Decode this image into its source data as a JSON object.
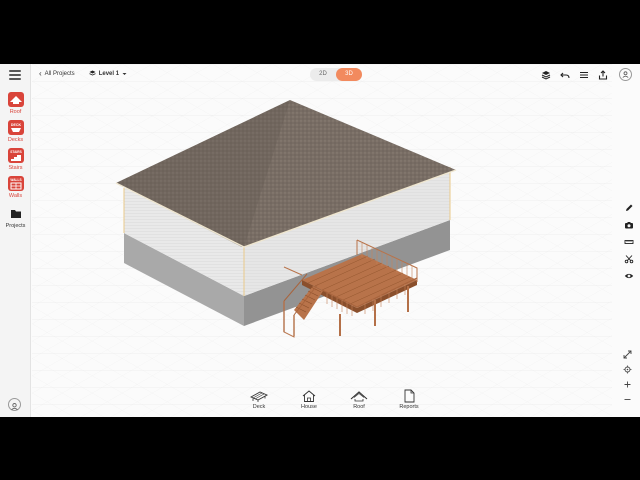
{
  "topbar": {
    "back_label": "All Projects",
    "level_label": "Level 1",
    "view_2d": "2D",
    "view_3d": "3D"
  },
  "left_tools": [
    {
      "label": "Roof",
      "icon": "roof-icon"
    },
    {
      "label": "Decks",
      "icon": "decks-icon"
    },
    {
      "label": "Stairs",
      "icon": "stairs-icon"
    },
    {
      "label": "Walls",
      "icon": "walls-icon"
    },
    {
      "label": "Projects",
      "icon": "folder-icon"
    }
  ],
  "tile_text": {
    "decks": "DECK",
    "stairs": "STAIRS",
    "walls": "WALLS"
  },
  "bottom_tools": [
    {
      "label": "Deck",
      "icon": "deck-icon"
    },
    {
      "label": "House",
      "icon": "house-icon"
    },
    {
      "label": "Roof",
      "icon": "roof-icon"
    },
    {
      "label": "Reports",
      "icon": "report-icon"
    }
  ],
  "colors": {
    "accent": "#f28a5e",
    "tool_red": "#d9443a",
    "roof": "#7a6f66",
    "siding": "#e4e4e4",
    "foundation": "#a7a7a7",
    "deck_wood": "#b8734a"
  }
}
